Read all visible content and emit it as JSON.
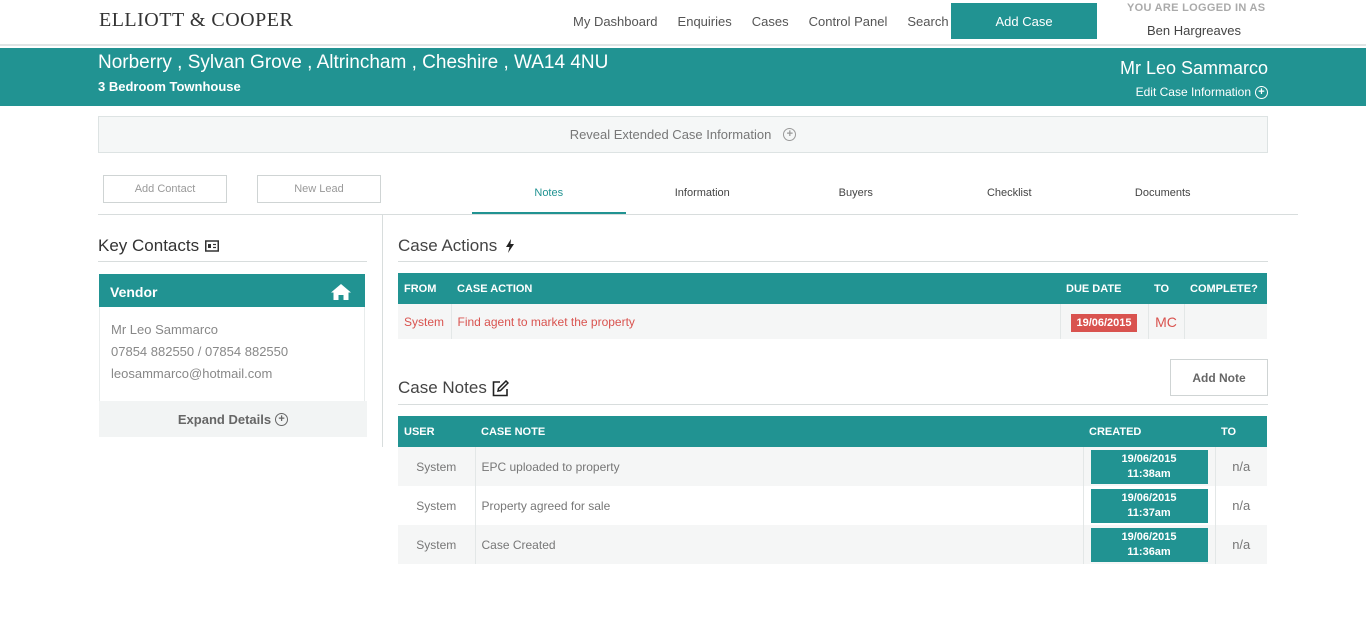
{
  "brand": {
    "logo_text": "ELLIOTT & COOPER",
    "accent": "#219392",
    "danger": "#d9534f"
  },
  "nav": {
    "items": [
      "My Dashboard",
      "Enquiries",
      "Cases",
      "Control Panel",
      "Search"
    ],
    "add_case_label": "Add Case",
    "login_label": "YOU ARE LOGGED IN AS",
    "user_name": "Ben Hargreaves"
  },
  "case": {
    "address": "Norberry , Sylvan Grove , Altrincham , Cheshire , WA14 4NU",
    "property_type": "3 Bedroom Townhouse",
    "client_name": "Mr Leo Sammarco",
    "edit_label": "Edit Case Information"
  },
  "reveal_label": "Reveal Extended Case Information",
  "buttons": {
    "add_contact": "Add Contact",
    "new_lead": "New Lead",
    "add_note": "Add Note"
  },
  "tabs": [
    {
      "label": "Notes",
      "active": true
    },
    {
      "label": "Information",
      "active": false
    },
    {
      "label": "Buyers",
      "active": false
    },
    {
      "label": "Checklist",
      "active": false
    },
    {
      "label": "Documents",
      "active": false
    }
  ],
  "key_contacts": {
    "title": "Key Contacts",
    "vendor_label": "Vendor",
    "name": "Mr Leo Sammarco",
    "phone": "07854 882550 / 07854 882550",
    "email": "leosammarco@hotmail.com",
    "expand_label": "Expand Details"
  },
  "case_actions": {
    "title": "Case Actions",
    "headers": [
      "FROM",
      "CASE ACTION",
      "DUE DATE",
      "TO",
      "COMPLETE?"
    ],
    "rows": [
      {
        "from": "System",
        "action": "Find agent to market the property",
        "due": "19/06/2015",
        "to": "MC",
        "complete": ""
      }
    ]
  },
  "case_notes": {
    "title": "Case Notes",
    "headers": [
      "USER",
      "CASE NOTE",
      "CREATED",
      "TO"
    ],
    "rows": [
      {
        "user": "System",
        "note": "EPC uploaded to property",
        "date": "19/06/2015",
        "time": "11:38am",
        "to": "n/a"
      },
      {
        "user": "System",
        "note": "Property agreed for sale",
        "date": "19/06/2015",
        "time": "11:37am",
        "to": "n/a"
      },
      {
        "user": "System",
        "note": "Case Created",
        "date": "19/06/2015",
        "time": "11:36am",
        "to": "n/a"
      }
    ]
  }
}
